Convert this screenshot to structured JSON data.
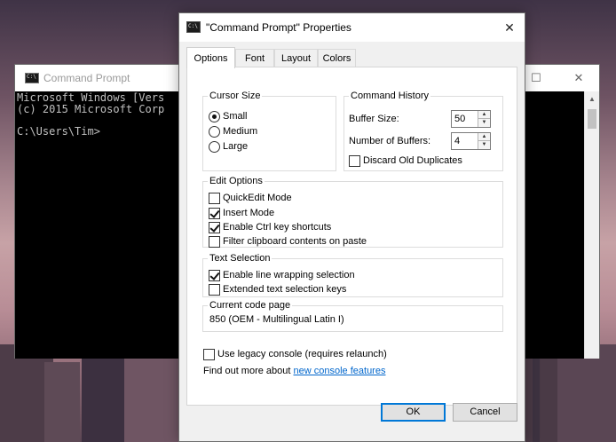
{
  "console": {
    "title": "Command Prompt",
    "lines": [
      "Microsoft Windows [Vers",
      "(c) 2015 Microsoft Corp",
      "",
      "C:\\Users\\Tim>"
    ]
  },
  "dialog": {
    "title": "\"Command Prompt\" Properties",
    "close_glyph": "✕",
    "tabs": [
      {
        "label": "Options",
        "active": true
      },
      {
        "label": "Font"
      },
      {
        "label": "Layout"
      },
      {
        "label": "Colors"
      }
    ],
    "cursor_size": {
      "legend": "Cursor Size",
      "options": [
        {
          "label": "Small",
          "selected": true
        },
        {
          "label": "Medium",
          "selected": false
        },
        {
          "label": "Large",
          "selected": false
        }
      ]
    },
    "command_history": {
      "legend": "Command History",
      "buffer_size_label": "Buffer Size:",
      "buffer_size_value": "50",
      "num_buffers_label": "Number of Buffers:",
      "num_buffers_value": "4",
      "discard_label": "Discard Old Duplicates"
    },
    "edit_options": {
      "legend": "Edit Options",
      "items": [
        {
          "label": "QuickEdit Mode",
          "checked": false
        },
        {
          "label": "Insert Mode",
          "checked": true
        },
        {
          "label": "Enable Ctrl key shortcuts",
          "checked": true
        },
        {
          "label": "Filter clipboard contents on paste",
          "checked": false
        }
      ]
    },
    "text_selection": {
      "legend": "Text Selection",
      "items": [
        {
          "label": "Enable line wrapping selection",
          "checked": true
        },
        {
          "label": "Extended text selection keys",
          "checked": false
        }
      ]
    },
    "code_page": {
      "legend": "Current code page",
      "value": "850   (OEM - Multilingual Latin I)"
    },
    "legacy_label": "Use legacy console (requires relaunch)",
    "find_out_text": "Find out more about",
    "find_out_link": "new console features",
    "ok_label": "OK",
    "cancel_label": "Cancel"
  },
  "colors": {
    "accent": "#0078d7",
    "link": "#0066cc",
    "console_bg": "#000000",
    "console_fg": "#c0c0c0"
  }
}
